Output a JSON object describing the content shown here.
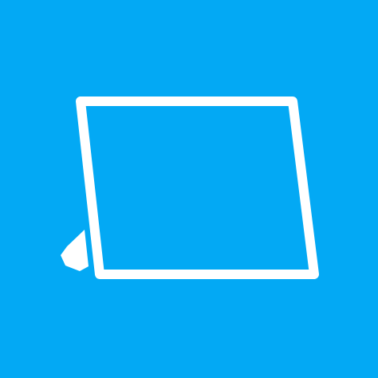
{
  "app_tile": {
    "icon": "tablet-icon",
    "background_color": "#03A9F4",
    "foreground_color": "#FFFFFF"
  }
}
